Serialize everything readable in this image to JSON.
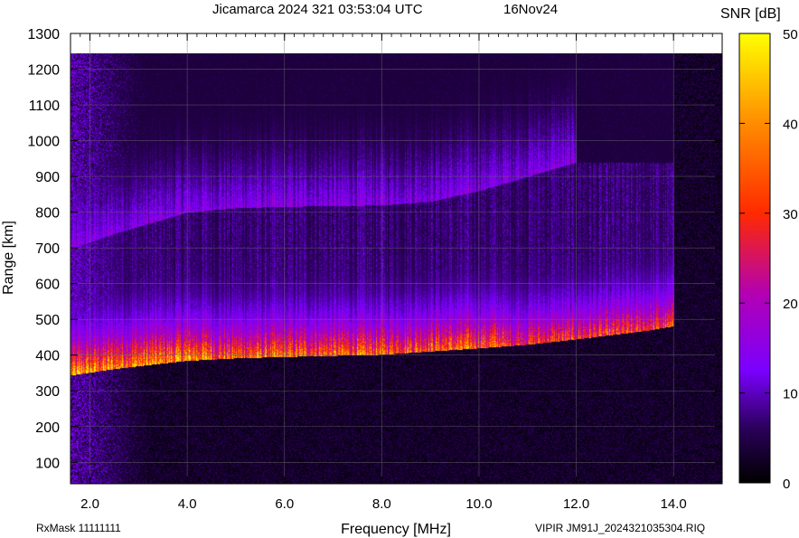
{
  "chart_data": {
    "type": "heatmap",
    "title": "Jicamarca 2024 321 03:53:04 UTC",
    "date_label": "16Nov24",
    "xlabel": "Frequency [MHz]",
    "ylabel": "Range [km]",
    "xlim": [
      1.6,
      15.0
    ],
    "ylim": [
      40,
      1300
    ],
    "x_ticks": [
      2.0,
      4.0,
      6.0,
      8.0,
      10.0,
      12.0,
      14.0
    ],
    "x_tick_labels": [
      "2.0",
      "4.0",
      "6.0",
      "8.0",
      "10.0",
      "12.0",
      "14.0"
    ],
    "y_ticks": [
      100,
      200,
      300,
      400,
      500,
      600,
      700,
      800,
      900,
      1000,
      1100,
      1200,
      1300
    ],
    "y_tick_labels": [
      "100",
      "200",
      "300",
      "400",
      "500",
      "600",
      "700",
      "800",
      "900",
      "1000",
      "1100",
      "1200",
      "1300"
    ],
    "grid": true,
    "colorbar": {
      "label": "SNR [dB]",
      "range": [
        0,
        50
      ],
      "ticks": [
        0,
        10,
        20,
        30,
        40,
        50
      ],
      "tick_labels": [
        "0",
        "10",
        "20",
        "30",
        "40",
        "50"
      ],
      "colormap": [
        "#000000",
        "#2a0058",
        "#7a00ff",
        "#b300b3",
        "#ff2a00",
        "#ff8c00",
        "#ffff00"
      ]
    },
    "traces": [
      {
        "name": "lower echo trace",
        "points": [
          [
            1.65,
            345
          ],
          [
            2.0,
            352
          ],
          [
            2.5,
            362
          ],
          [
            3.0,
            370
          ],
          [
            4.0,
            385
          ],
          [
            5.0,
            392
          ],
          [
            6.0,
            396
          ],
          [
            8.0,
            402
          ],
          [
            10.0,
            420
          ],
          [
            11.0,
            430
          ],
          [
            12.0,
            445
          ],
          [
            13.5,
            470
          ],
          [
            14.0,
            482
          ]
        ],
        "peak_snr_db": 42
      },
      {
        "name": "upper echo trace",
        "points": [
          [
            1.65,
            700
          ],
          [
            2.5,
            740
          ],
          [
            3.0,
            760
          ],
          [
            4.0,
            800
          ],
          [
            5.0,
            812
          ],
          [
            6.0,
            816
          ],
          [
            8.0,
            820
          ],
          [
            9.0,
            830
          ],
          [
            10.0,
            860
          ],
          [
            11.0,
            900
          ],
          [
            12.0,
            940
          ]
        ],
        "peak_snr_db": 15
      }
    ]
  },
  "footer": {
    "left": "RxMask 11111111",
    "right": "VIPIR  JM91J_2024321035304.RIQ"
  }
}
